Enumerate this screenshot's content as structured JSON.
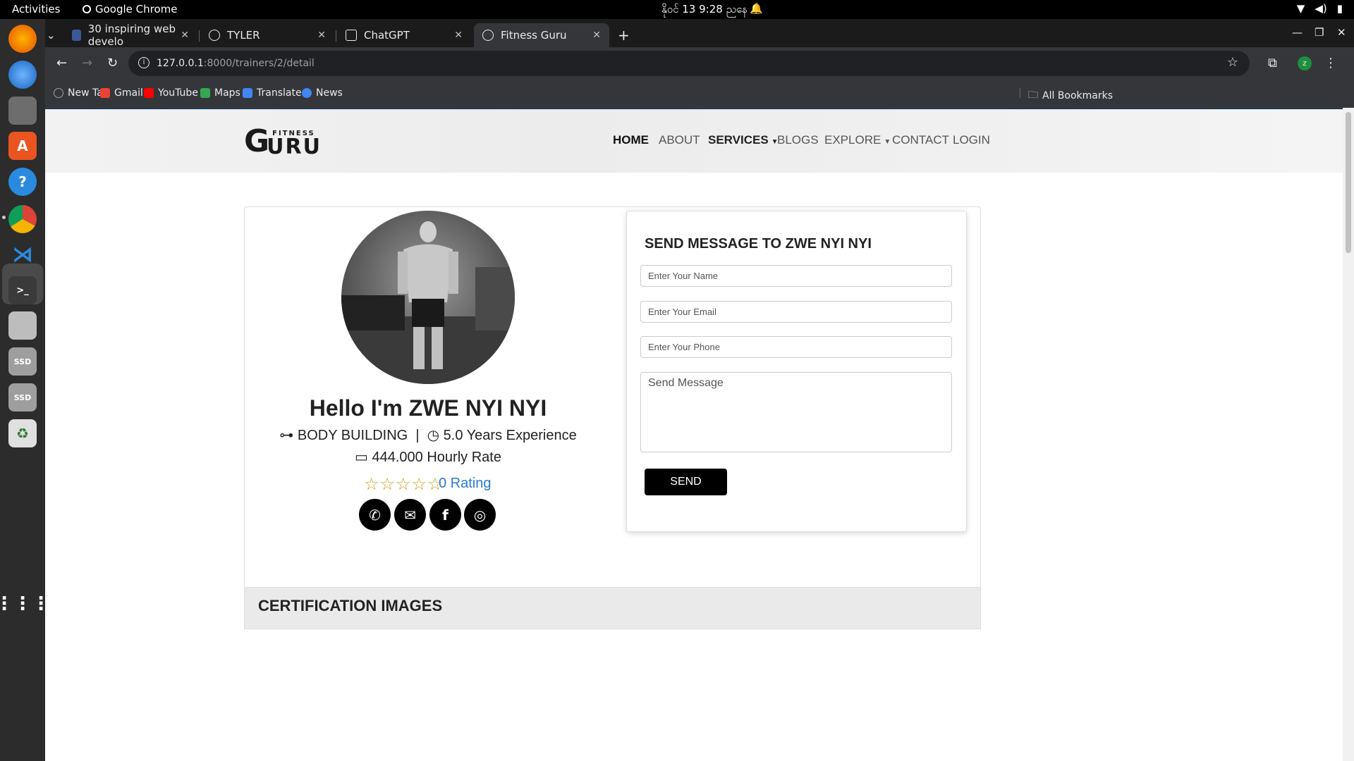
{
  "topbar": {
    "activities": "Activities",
    "app_name": "Google Chrome",
    "clock": "နိုဝင် 13  9:28 ညနေ"
  },
  "tabs": [
    {
      "label": "30 inspiring web develo",
      "active": false
    },
    {
      "label": "TYLER",
      "active": false
    },
    {
      "label": "ChatGPT",
      "active": false
    },
    {
      "label": "Fitness Guru",
      "active": true
    }
  ],
  "omnibox": {
    "host": "127.0.0.1",
    "path": ":8000/trainers/2/detail"
  },
  "profile_initial": "z",
  "bookmarks": [
    {
      "label": "New Tab",
      "color": "#9aa0a6"
    },
    {
      "label": "Gmail",
      "color": "#ea4335"
    },
    {
      "label": "YouTube",
      "color": "#ff0000"
    },
    {
      "label": "Maps",
      "color": "#34a853"
    },
    {
      "label": "Translate",
      "color": "#4285f4"
    },
    {
      "label": "News",
      "color": "#4285f4"
    }
  ],
  "all_bookmarks": "All Bookmarks",
  "site": {
    "logo_g": "G",
    "logo_fitness": "FITNESS",
    "logo_uru": "URU",
    "nav": {
      "home": "HOME",
      "about": "ABOUT",
      "services": "SERVICES",
      "blogs": "BLOGS",
      "explore": "EXPLORE",
      "contact": "CONTACT",
      "login": "LOGIN"
    }
  },
  "trainer": {
    "hello": "Hello I'm ZWE NYI NYI",
    "specialty": "BODY BUILDING",
    "separator": "|",
    "experience": "5.0 Years Experience",
    "rate": "444.000 Hourly Rate",
    "stars": "☆☆☆☆☆",
    "rating": "0 Rating"
  },
  "form": {
    "title": "SEND MESSAGE TO ZWE NYI NYI",
    "name_placeholder": "Enter Your Name",
    "email_placeholder": "Enter Your Email",
    "phone_placeholder": "Enter Your Phone",
    "message_placeholder": "Send Message",
    "send_label": "SEND"
  },
  "cert_title": "CERTIFICATION IMAGES",
  "colors": {
    "accent_black": "#000000",
    "rating_blue": "#2a7ad5",
    "star_gold": "#d4a017"
  }
}
